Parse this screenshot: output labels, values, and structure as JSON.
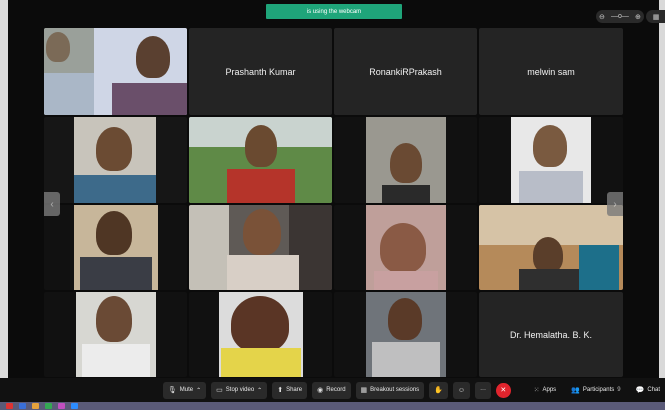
{
  "banner": {
    "text": "is using the webcam"
  },
  "tiles": {
    "t1": "Prashanth Kumar",
    "t2": "RonankiRPrakash",
    "t3": "melwin sam",
    "t4": "Dr. Hemalatha. B. K."
  },
  "nav": {
    "left": "‹",
    "right": "›"
  },
  "toolbar": {
    "mute": "Mute",
    "stop_video": "Stop video",
    "share": "Share",
    "record": "Record",
    "breakout": "Breakout sessions",
    "more": "···",
    "apps": "Apps",
    "participants": "Participants",
    "participants_count": "9",
    "chat": "Chat"
  },
  "colors": {
    "end": "#e0242d",
    "banner": "#1fa57a"
  }
}
